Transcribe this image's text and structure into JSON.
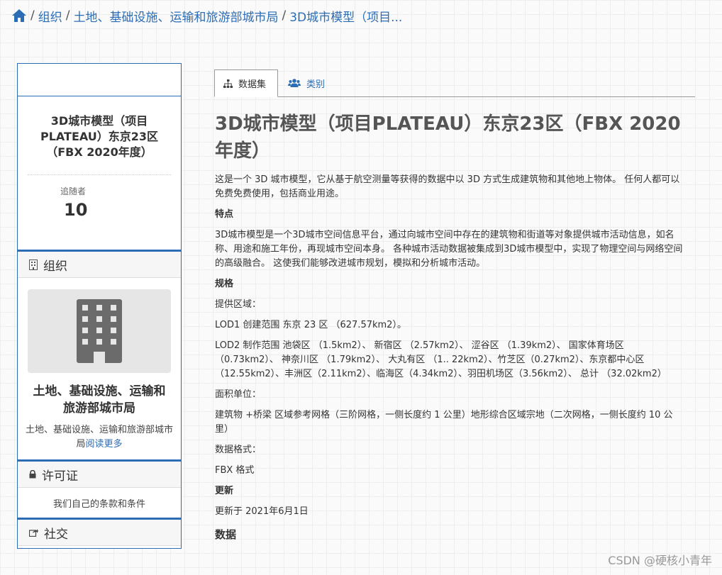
{
  "breadcrumb": {
    "items": [
      "组织",
      "土地、基础设施、运输和旅游部城市局",
      "3D城市模型（项目..."
    ]
  },
  "sidebar": {
    "dataset_title": "3D城市模型（项目PLATEAU）东京23区（FBX 2020年度）",
    "followers_label": "追随者",
    "followers_count": "10",
    "org_heading": "组织",
    "org_name": "土地、基础设施、运输和旅游部城市局",
    "org_desc": "土地、基础设施、运输和旅游部城市局",
    "read_more": "阅读更多",
    "license_heading": "许可证",
    "license_text": "我们自己的条款和条件",
    "social_heading": "社交"
  },
  "tabs": {
    "dataset": "数据集",
    "groups": "类别"
  },
  "main": {
    "title": "3D城市模型（项目PLATEAU）东京23区（FBX 2020年度）",
    "intro": "这是一个 3D 城市模型，它从基于航空测量等获得的数据中以 3D 方式生成建筑物和其他地上物体。 任何人都可以免费免费使用，包括商业用途。",
    "features_heading": "特点",
    "features_text": "3D城市模型是一个3D城市空间信息平台，通过向城市空间中存在的建筑物和街道等对象提供城市活动信息，如名称、用途和施工年份，再现城市空间本身。 各种城市活动数据被集成到3D城市模型中，实现了物理空间与网络空间的高级融合。 这使我们能够改进城市规划，模拟和分析城市活动。",
    "spec_heading": "规格",
    "area_label": "提供区域：",
    "lod1": "LOD1 创建范围 东京 23 区 （627.57km2）。",
    "lod2": "LOD2 制作范围 池袋区 （1.5km2）、 新宿区 （2.57km2）、 涩谷区 （1.39km2）、 国家体育场区 （0.73km2）、 神奈川区 （1.79km2）、 大丸有区 （1.. 22km2）、竹芝区（0.27km2）、东京都中心区（12.55km2）、丰洲区（2.11km2）、临海区（4.34km2）、羽田机场区（3.56km2）、 总计 （32.02km2）",
    "unit_label": "面积单位：",
    "unit_text": "建筑物 +桥梁 区域参考网格（三阶网格，一侧长度约 1 公里）地形综合区域宗地（二次网格，一侧长度约 10 公里）",
    "format_label": "数据格式：",
    "format_text": "FBX 格式",
    "update_heading": "更新",
    "update_text": "更新于 2021年6月1日",
    "data_heading": "数据"
  },
  "watermark": "CSDN @硬核小青年",
  "colors": {
    "accent": "#2d6db5"
  }
}
